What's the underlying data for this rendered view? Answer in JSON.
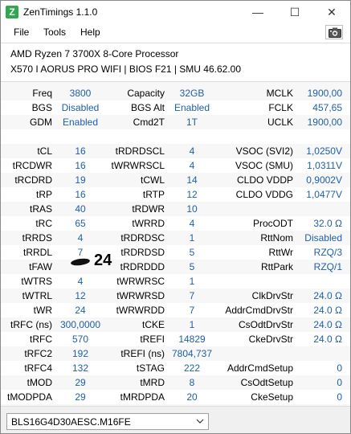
{
  "window": {
    "title": "ZenTimings 1.1.0",
    "app_icon_letter": "Z",
    "minimize_glyph": "—",
    "maximize_glyph": "☐",
    "close_glyph": "✕"
  },
  "menu": {
    "file": "File",
    "tools": "Tools",
    "help": "Help",
    "screenshot_icon": "camera-icon"
  },
  "system": {
    "cpu": "AMD Ryzen 7 3700X 8-Core Processor",
    "board": "X570 I AORUS PRO WIFI | BIOS F21 | SMU 46.62.00"
  },
  "top_rows": [
    {
      "l1": "Freq",
      "v1": "3800",
      "l2": "Capacity",
      "v2": "32GB",
      "l3": "MCLK",
      "v3": "1900,00"
    },
    {
      "l1": "BGS",
      "v1": "Disabled",
      "l2": "BGS Alt",
      "v2": "Enabled",
      "l3": "FCLK",
      "v3": "457,65"
    },
    {
      "l1": "GDM",
      "v1": "Enabled",
      "l2": "Cmd2T",
      "v2": "1T",
      "l3": "UCLK",
      "v3": "1900,00"
    }
  ],
  "timing_rows": [
    {
      "l1": "tCL",
      "v1": "16",
      "l2": "tRDRDSCL",
      "v2": "4",
      "l3": "VSOC (SVI2)",
      "v3": "1,0250V"
    },
    {
      "l1": "tRCDWR",
      "v1": "16",
      "l2": "tWRWRSCL",
      "v2": "4",
      "l3": "VSOC (SMU)",
      "v3": "1,0311V"
    },
    {
      "l1": "tRCDRD",
      "v1": "19",
      "l2": "tCWL",
      "v2": "14",
      "l3": "CLDO VDDP",
      "v3": "0,9002V"
    },
    {
      "l1": "tRP",
      "v1": "16",
      "l2": "tRTP",
      "v2": "12",
      "l3": "CLDO VDDG",
      "v3": "1,0477V"
    },
    {
      "l1": "tRAS",
      "v1": "40",
      "l2": "tRDWR",
      "v2": "10",
      "l3": "",
      "v3": ""
    },
    {
      "l1": "tRC",
      "v1": "65",
      "l2": "tWRRD",
      "v2": "4",
      "l3": "ProcODT",
      "v3": "32.0 Ω"
    },
    {
      "l1": "tRRDS",
      "v1": "4",
      "l2": "tRDRDSC",
      "v2": "1",
      "l3": "RttNom",
      "v3": "Disabled"
    },
    {
      "l1": "tRRDL",
      "v1": "7",
      "l2": "tRDRDSD",
      "v2": "5",
      "l3": "RttWr",
      "v3": "RZQ/3"
    },
    {
      "l1": "tFAW",
      "v1": "",
      "l2": "tRDRDDD",
      "v2": "5",
      "l3": "RttPark",
      "v3": "RZQ/1"
    },
    {
      "l1": "tWTRS",
      "v1": "4",
      "l2": "tWRWRSC",
      "v2": "1",
      "l3": "",
      "v3": ""
    },
    {
      "l1": "tWTRL",
      "v1": "12",
      "l2": "tWRWRSD",
      "v2": "7",
      "l3": "ClkDrvStr",
      "v3": "24.0 Ω"
    },
    {
      "l1": "tWR",
      "v1": "24",
      "l2": "tWRWRDD",
      "v2": "7",
      "l3": "AddrCmdDrvStr",
      "v3": "24.0 Ω"
    },
    {
      "l1": "tRFC (ns)",
      "v1": "300,0000",
      "l2": "tCKE",
      "v2": "1",
      "l3": "CsOdtDrvStr",
      "v3": "24.0 Ω"
    },
    {
      "l1": "tRFC",
      "v1": "570",
      "l2": "tREFI",
      "v2": "14829",
      "l3": "CkeDrvStr",
      "v3": "24.0 Ω"
    },
    {
      "l1": "tRFC2",
      "v1": "192",
      "l2": "tREFI (ns)",
      "v2": "7804,737",
      "l3": "",
      "v3": ""
    },
    {
      "l1": "tRFC4",
      "v1": "132",
      "l2": "tSTAG",
      "v2": "222",
      "l3": "AddrCmdSetup",
      "v3": "0"
    },
    {
      "l1": "tMOD",
      "v1": "29",
      "l2": "tMRD",
      "v2": "8",
      "l3": "CsOdtSetup",
      "v3": "0"
    },
    {
      "l1": "tMODPDA",
      "v1": "29",
      "l2": "tMRDPDA",
      "v2": "20",
      "l3": "CkeSetup",
      "v3": "0"
    }
  ],
  "annotation": {
    "tfaw_handwritten": "24"
  },
  "footer": {
    "profile": "BLS16G4D30AESC.M16FE"
  },
  "colors": {
    "value_blue": "#1f5fa8",
    "icon_green": "#2fa84f"
  }
}
